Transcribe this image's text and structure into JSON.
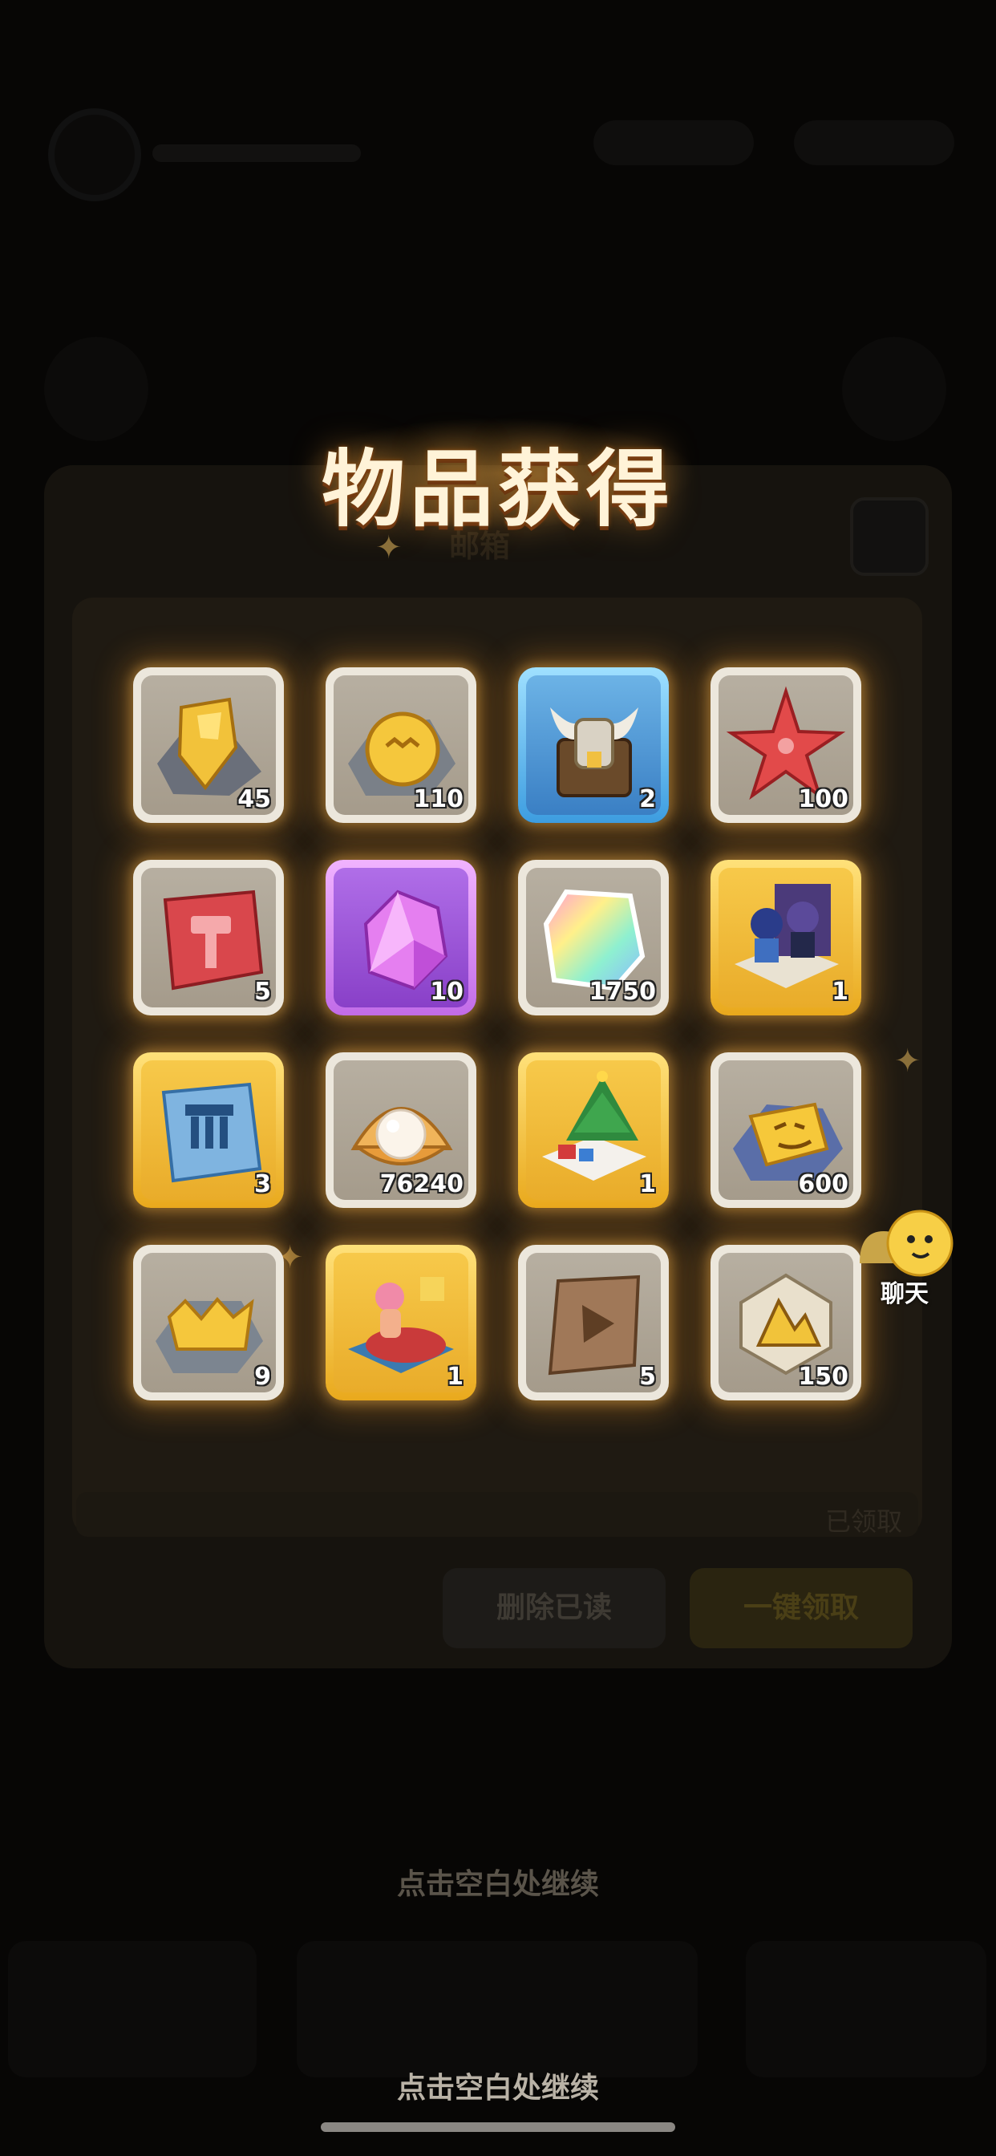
{
  "popup": {
    "title": "物品获得",
    "continue_hint": "点击空白处继续",
    "chat_label": "聊天"
  },
  "background": {
    "modal_title": "邮箱",
    "claimed_tag": "已领取",
    "delete_read_label": "删除已读",
    "claim_all_label": "一键领取",
    "continue_hint": "点击空白处继续"
  },
  "items": [
    {
      "icon": "golden-ore-chunk-icon",
      "rarity": "grey",
      "quantity": "45"
    },
    {
      "icon": "gold-coin-ore-icon",
      "rarity": "grey",
      "quantity": "110"
    },
    {
      "icon": "horned-armor-chest-icon",
      "rarity": "blue",
      "quantity": "2"
    },
    {
      "icon": "red-starfish-icon",
      "rarity": "grey",
      "quantity": "100"
    },
    {
      "icon": "red-hammer-ticket-icon",
      "rarity": "grey",
      "quantity": "5"
    },
    {
      "icon": "purple-crystal-icon",
      "rarity": "purple",
      "quantity": "10"
    },
    {
      "icon": "rainbow-gem-icon",
      "rarity": "grey",
      "quantity": "1750"
    },
    {
      "icon": "character-diorama-icon",
      "rarity": "gold",
      "quantity": "1"
    },
    {
      "icon": "blue-building-ticket-icon",
      "rarity": "gold",
      "quantity": "3"
    },
    {
      "icon": "pearl-shell-icon",
      "rarity": "grey",
      "quantity": "76240"
    },
    {
      "icon": "christmas-tree-diorama-icon",
      "rarity": "gold",
      "quantity": "1"
    },
    {
      "icon": "yellow-face-block-icon",
      "rarity": "grey",
      "quantity": "600"
    },
    {
      "icon": "gold-crown-ore-icon",
      "rarity": "grey",
      "quantity": "9"
    },
    {
      "icon": "mermaid-diorama-icon",
      "rarity": "gold",
      "quantity": "1"
    },
    {
      "icon": "play-ticket-icon",
      "rarity": "grey",
      "quantity": "5"
    },
    {
      "icon": "mountain-emblem-icon",
      "rarity": "grey",
      "quantity": "150"
    }
  ]
}
